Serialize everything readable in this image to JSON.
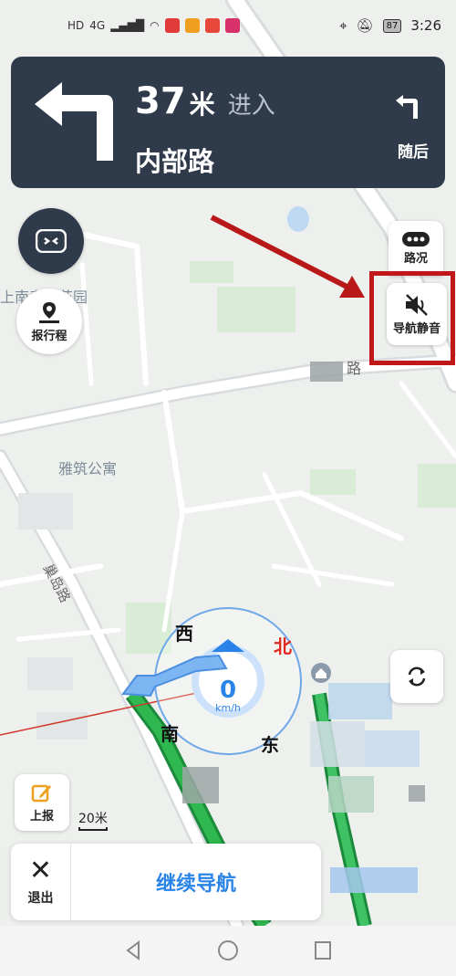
{
  "status_bar": {
    "left_text": "HD",
    "network": "4G",
    "battery": "87",
    "time": "3:26"
  },
  "nav_card": {
    "distance": "37",
    "distance_unit": "米",
    "action": "进入",
    "road": "内部路",
    "then_label": "随后"
  },
  "buttons": {
    "trip": "报行程",
    "traffic": "路况",
    "mute": "导航静音",
    "report": "上报",
    "exit": "退出",
    "continue": "继续导航"
  },
  "scale": "20米",
  "map_labels": {
    "apartment": "雅筑公寓",
    "garden": "上南春天花园",
    "road_label": "路",
    "road_vertical": "巢岛路"
  },
  "compass": {
    "west": "西",
    "north": "北",
    "south": "南",
    "east": "东"
  },
  "speed": {
    "value": "0",
    "unit": "km/h"
  },
  "colors": {
    "nav_bg": "#2f3a4a",
    "accent": "#2a84e8",
    "route": "#1fa34a",
    "highlight": "#c01818"
  }
}
